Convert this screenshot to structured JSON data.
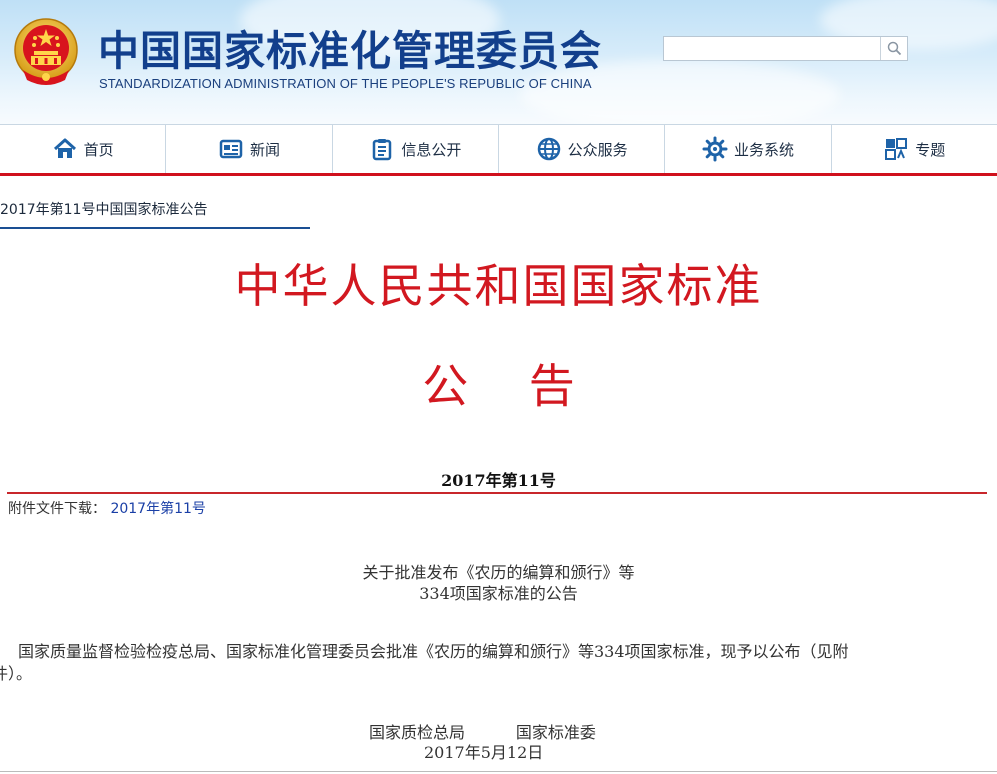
{
  "header": {
    "title": "中国国家标准化管理委员会",
    "subtitle": "STANDARDIZATION ADMINISTRATION OF THE PEOPLE'S REPUBLIC OF CHINA",
    "search": {
      "value": "",
      "placeholder": ""
    },
    "colors": {
      "title": "#123f8c",
      "sky": "#bfe0f6"
    }
  },
  "nav": {
    "items": [
      {
        "label": "首页",
        "icon": "home-icon"
      },
      {
        "label": "新闻",
        "icon": "news-icon"
      },
      {
        "label": "信息公开",
        "icon": "clipboard-icon"
      },
      {
        "label": "公众服务",
        "icon": "globe-icon"
      },
      {
        "label": "业务系统",
        "icon": "gear-icon"
      },
      {
        "label": "专题",
        "icon": "topic-icon"
      }
    ],
    "accent": "#d0101c"
  },
  "tab": {
    "label": "2017年第11号中国国家标准公告"
  },
  "announcement": {
    "heading": "中华人民共和国国家标准",
    "subheading": "公　 告",
    "number": "2017年第11号",
    "attachment_label": "附件文件下载：",
    "attachment_link": "2017年第11号",
    "subject_line1": "关于批准发布《农历的编算和颁行》等",
    "subject_line2": "334项国家标准的公告",
    "body_line1": "国家质量监督检验检疫总局、国家标准化管理委员会批准《农历的编算和颁行》等334项国家标准，现予以公布（见附",
    "body_line2": "件）。",
    "signature": "国家质检总局          国家标准委",
    "date": "2017年5月12日",
    "colors": {
      "red": "#d21820",
      "link": "#1a3fa6"
    }
  }
}
